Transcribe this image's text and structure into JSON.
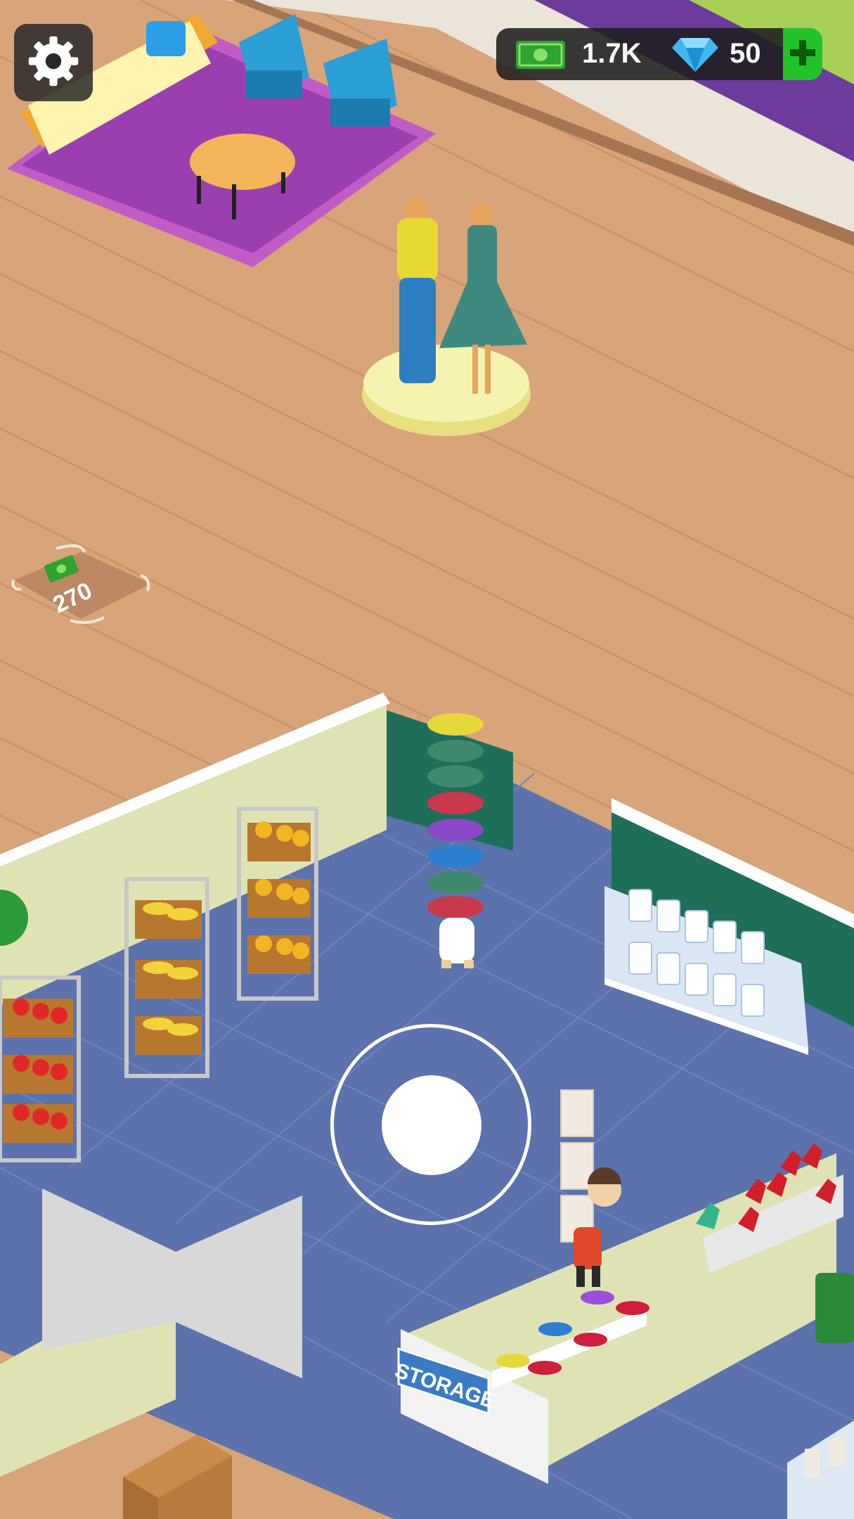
{
  "hud": {
    "settings_icon": "gear-icon",
    "cash_icon": "cash-icon",
    "cash_amount": "1.7K",
    "gem_icon": "diamond-icon",
    "gem_amount": "50",
    "add_currency_icon": "plus-icon"
  },
  "world": {
    "expansion_tile": {
      "icon": "cash-icon",
      "price": "270"
    },
    "storage_sign": "STORAGE"
  },
  "controls": {
    "joystick": "virtual-joystick"
  },
  "colors": {
    "wood_floor": "#d8a47a",
    "store_floor": "#5b72ad",
    "rug": "#9b3fb0",
    "accent_green": "#22c22a",
    "storage_sign": "#3a7cc4"
  }
}
